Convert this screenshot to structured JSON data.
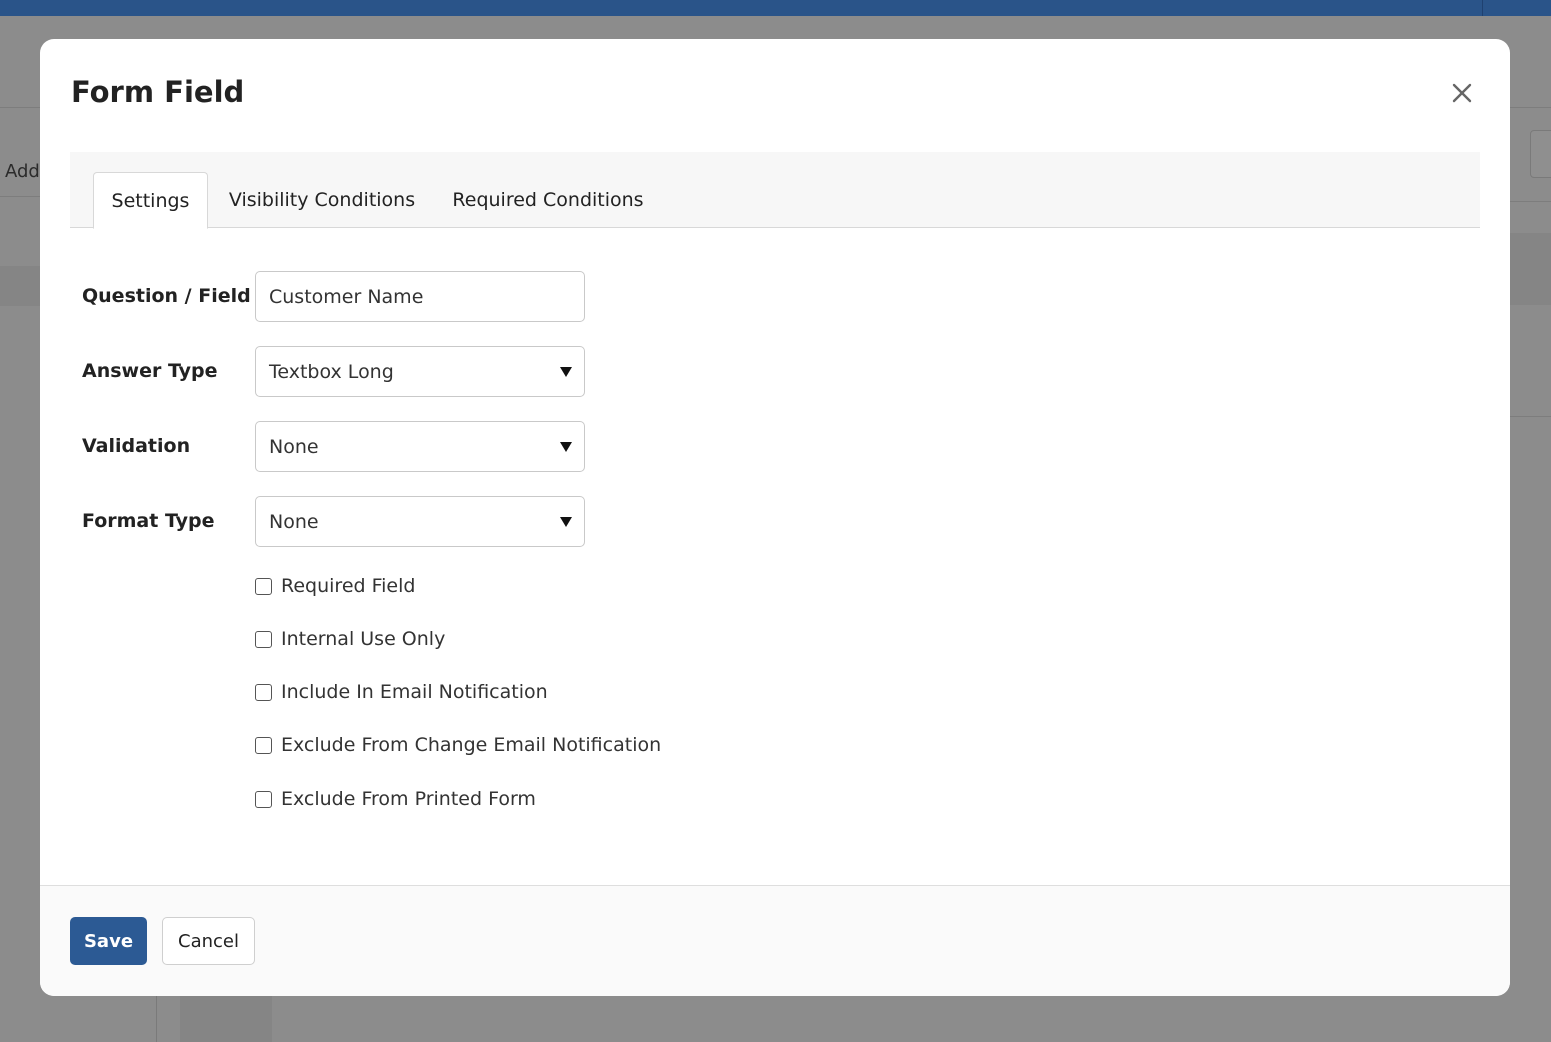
{
  "background": {
    "partial_label": "Add"
  },
  "modal": {
    "title": "Form Field",
    "close_icon": "close-icon"
  },
  "tabs": [
    {
      "label": "Settings",
      "active": true
    },
    {
      "label": "Visibility Conditions",
      "active": false
    },
    {
      "label": "Required Conditions",
      "active": false
    }
  ],
  "form": {
    "question": {
      "label": "Question / Field",
      "value": "Customer Name"
    },
    "answer_type": {
      "label": "Answer Type",
      "value": "Textbox Long"
    },
    "validation": {
      "label": "Validation",
      "value": "None"
    },
    "format_type": {
      "label": "Format Type",
      "value": "None"
    }
  },
  "checkboxes": [
    {
      "label": "Required Field",
      "checked": false
    },
    {
      "label": "Internal Use Only",
      "checked": false
    },
    {
      "label": "Include In Email Notification",
      "checked": false
    },
    {
      "label": "Exclude From Change Email Notification",
      "checked": false
    },
    {
      "label": "Exclude From Printed Form",
      "checked": false
    }
  ],
  "footer": {
    "save_label": "Save",
    "cancel_label": "Cancel"
  },
  "colors": {
    "primary": "#2c5a94",
    "topbar": "#2a5489",
    "overlay": "#8c8c8c"
  }
}
